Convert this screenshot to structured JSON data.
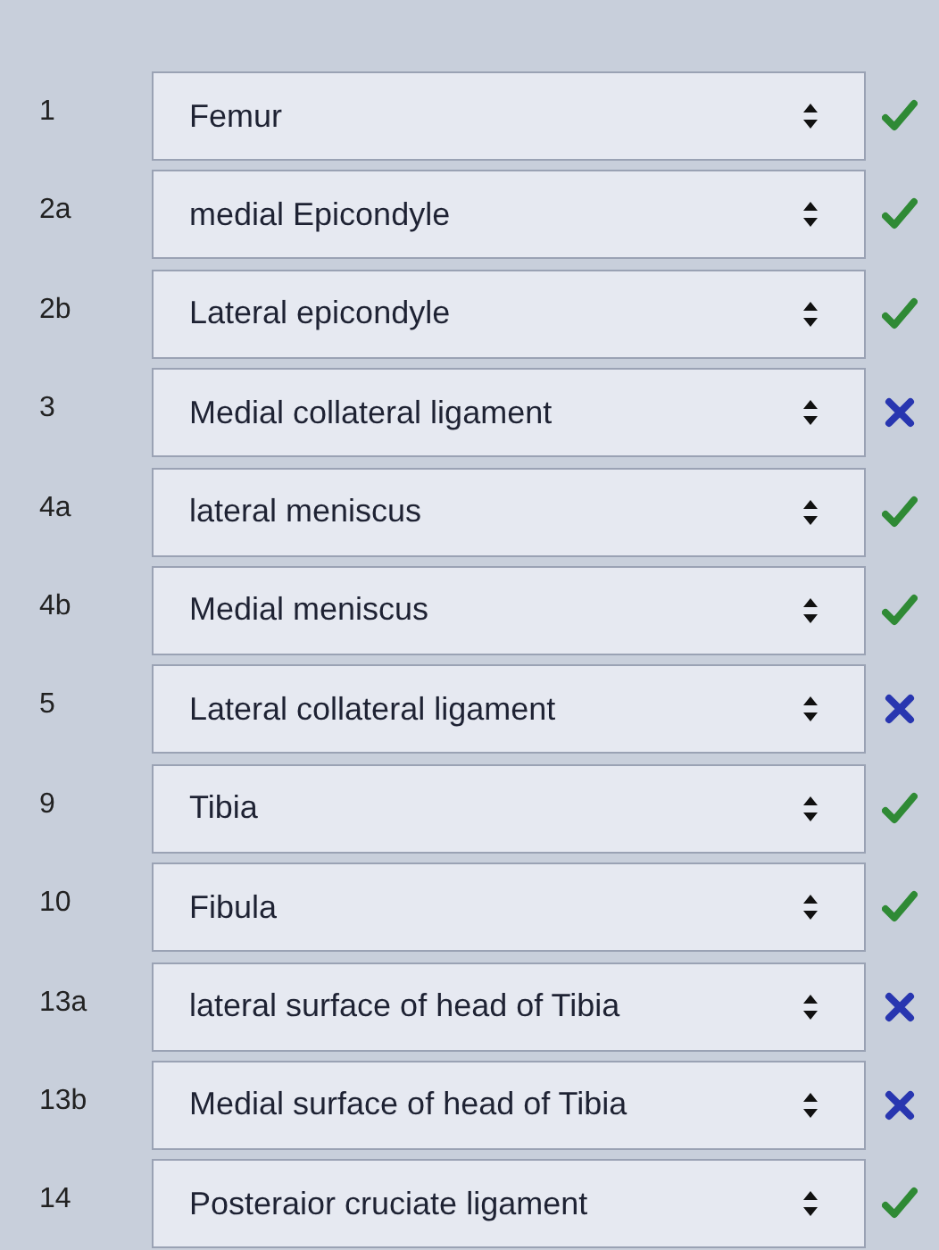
{
  "rows": [
    {
      "number": "1",
      "answer": "Femur",
      "correct": true
    },
    {
      "number": "2a",
      "answer": "medial Epicondyle",
      "correct": true
    },
    {
      "number": "2b",
      "answer": "Lateral epicondyle",
      "correct": true
    },
    {
      "number": "3",
      "answer": "Medial collateral ligament",
      "correct": false
    },
    {
      "number": "4a",
      "answer": "lateral meniscus",
      "correct": true
    },
    {
      "number": "4b",
      "answer": "Medial meniscus",
      "correct": true
    },
    {
      "number": "5",
      "answer": "Lateral collateral ligament",
      "correct": false
    },
    {
      "number": "9",
      "answer": "Tibia",
      "correct": true
    },
    {
      "number": "10",
      "answer": "Fibula",
      "correct": true
    },
    {
      "number": "13a",
      "answer": "lateral surface of head of Tibia",
      "correct": false
    },
    {
      "number": "13b",
      "answer": "Medial surface of head of Tibia",
      "correct": false
    },
    {
      "number": "14",
      "answer": "Posteraior cruciate ligament",
      "correct": true
    }
  ]
}
